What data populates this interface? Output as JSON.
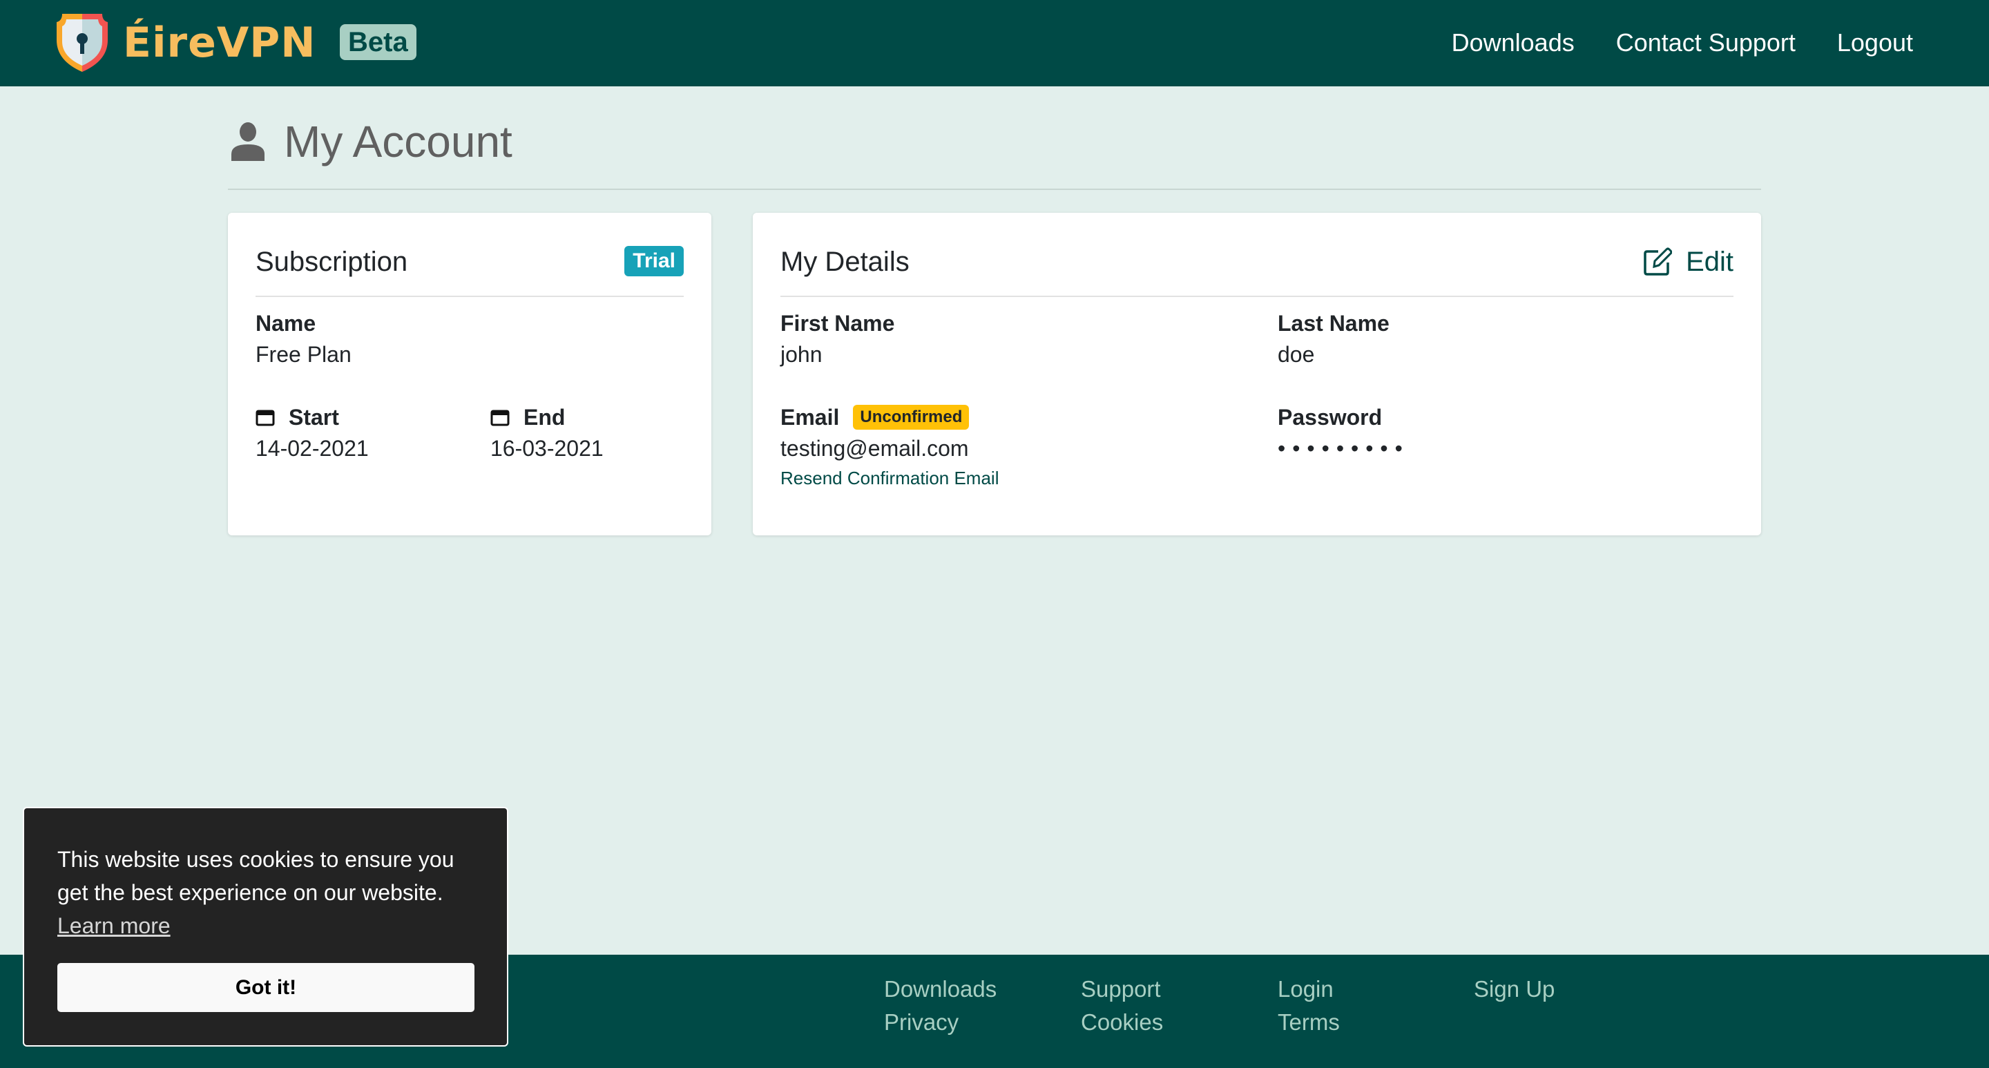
{
  "header": {
    "brand": "ÉireVPN",
    "badge": "Beta",
    "nav": [
      {
        "label": "Downloads"
      },
      {
        "label": "Contact Support"
      },
      {
        "label": "Logout"
      }
    ]
  },
  "page": {
    "title": "My Account"
  },
  "subscription": {
    "title": "Subscription",
    "badge": "Trial",
    "name_label": "Name",
    "name_value": "Free Plan",
    "start_label": "Start",
    "start_value": "14-02-2021",
    "end_label": "End",
    "end_value": "16-03-2021"
  },
  "details": {
    "title": "My Details",
    "edit_label": "Edit",
    "first_name_label": "First Name",
    "first_name_value": "john",
    "last_name_label": "Last Name",
    "last_name_value": "doe",
    "email_label": "Email",
    "email_status": "Unconfirmed",
    "email_value": "testing@email.com",
    "resend_label": "Resend Confirmation Email",
    "password_label": "Password",
    "password_value": "•••••••••"
  },
  "footer": {
    "links": [
      {
        "label": "Downloads"
      },
      {
        "label": "Privacy"
      },
      {
        "label": "Support"
      },
      {
        "label": "Cookies"
      },
      {
        "label": "Login"
      },
      {
        "label": "Terms"
      },
      {
        "label": "Sign Up"
      }
    ]
  },
  "cookie": {
    "message": "This website uses cookies to ensure you get the best experience on our website.",
    "learn_more": "Learn more",
    "accept": "Got it!"
  },
  "colors": {
    "brand_dark": "#004a46",
    "brand_logo": "#f7bd5e",
    "page_bg": "#e2efec",
    "trial": "#17a2b8",
    "unconfirmed": "#ffc107"
  }
}
